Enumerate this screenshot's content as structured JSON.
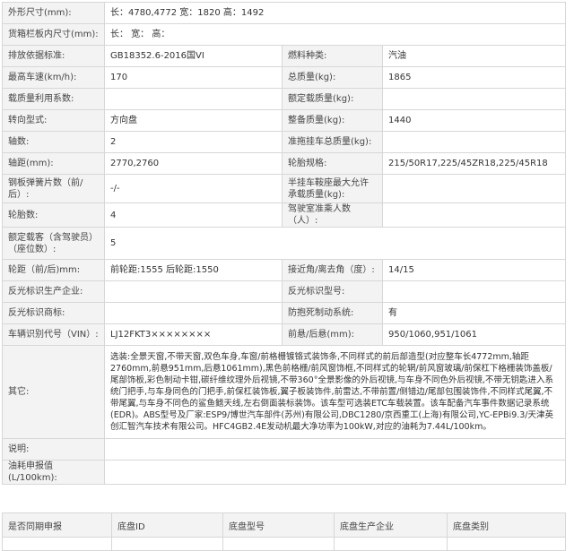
{
  "spec": {
    "dimensions_label": "外形尺寸(mm):",
    "dimensions_value": "长：4780,4772 宽：1820 高：1492",
    "cargo_label": "货箱栏板内尺寸(mm):",
    "cargo_value": "长：  宽：  高：",
    "emission_label": "排放依据标准:",
    "emission_value": "GB18352.6-2016国VI",
    "fuel_label": "燃料种类:",
    "fuel_value": "汽油",
    "max_speed_label": "最高车速(km/h):",
    "max_speed_value": "170",
    "total_mass_label": "总质量(kg):",
    "total_mass_value": "1865",
    "load_util_label": "载质量利用系数:",
    "load_util_value": "",
    "rated_load_label": "额定载质量(kg):",
    "rated_load_value": "",
    "steering_label": "转向型式:",
    "steering_value": "方向盘",
    "curb_mass_label": "整备质量(kg):",
    "curb_mass_value": "1440",
    "axles_label": "轴数:",
    "axles_value": "2",
    "trailer_label": "准拖挂车总质量(kg):",
    "trailer_value": "",
    "wheelbase_label": "轴距(mm):",
    "wheelbase_value": "2770,2760",
    "tyre_label": "轮胎规格:",
    "tyre_value": "215/50R17,225/45ZR18,225/45R18",
    "leaf_label": "钢板弹簧片数（前/后）:",
    "leaf_value": "-/-",
    "saddle_label": "半挂车鞍座最大允许承载质量(kg):",
    "saddle_value": "",
    "tyre_count_label": "轮胎数:",
    "tyre_count_value": "4",
    "cab_seats_label": "驾驶室准乘人数（人）:",
    "cab_seats_value": "",
    "rated_pass_label": "额定载客（含驾驶员）（座位数）:",
    "rated_pass_value": "5",
    "track_label": "轮距（前/后)mm:",
    "track_value": "前轮距:1555 后轮距:1550",
    "approach_label": "接近角/离去角（度）:",
    "approach_value": "14/15",
    "reflect_maker_label": "反光标识生产企业:",
    "reflect_maker_value": "",
    "reflect_model_label": "反光标识型号:",
    "reflect_model_value": "",
    "reflect_brand_label": "反光标识商标:",
    "reflect_brand_value": "",
    "abs_label": "防抱死制动系统:",
    "abs_value": "有",
    "vin_label": "车辆识别代号（VIN）:",
    "vin_value": "LJ12FKT3××××××××",
    "overhang_label": "前悬/后悬(mm):",
    "overhang_value": "950/1060,951/1061",
    "other_label": "其它:",
    "other_value": "选装:全景天窗,不带天窗,双色车身,车窗/前格栅镀铬式装饰条,不同样式的前后部造型(对应整车长4772mm,轴距2760mm,前悬951mm,后悬1061mm),黑色前格栅/前风窗饰框,不同样式的轮辋/前风窗玻璃/前保杠下格栅装饰盖板/尾部饰板,彩色制动卡钳,碳纤维纹理外后视镜,不带360°全景影像的外后视镜,与车身不同色外后视镜,不带无钥匙进入系统门把手,与车身同色的门把手,前保杠装饰板,翼子板装饰件,前雷达,不带前置/侧错边/尾部包围装饰件,不同样式尾翼,不带尾翼,与车身不同色的鲨鱼鳍天线,左右倒面装标装饰。该车型可选装ETC车载装置。该车配备汽车事件数据记录系统(EDR)。ABS型号及厂家:ESP9/博世汽车部件(苏州)有限公司,DBC1280/京西重工(上海)有限公司,YC-EPBi9.3/天津英创汇智汽车技术有限公司。HFC4GB2.4E发动机最大净功率为100kW,对应的油耗为7.44L/100km。",
    "note_label": "说明:",
    "note_value": "",
    "fuel_decl_label": "油耗申报值(L/100km):",
    "fuel_decl_value": ""
  },
  "chassis": {
    "col1": "是否同期申报",
    "col2": "底盘ID",
    "col3": "底盘型号",
    "col4": "底盘生产企业",
    "col5": "底盘类别"
  }
}
